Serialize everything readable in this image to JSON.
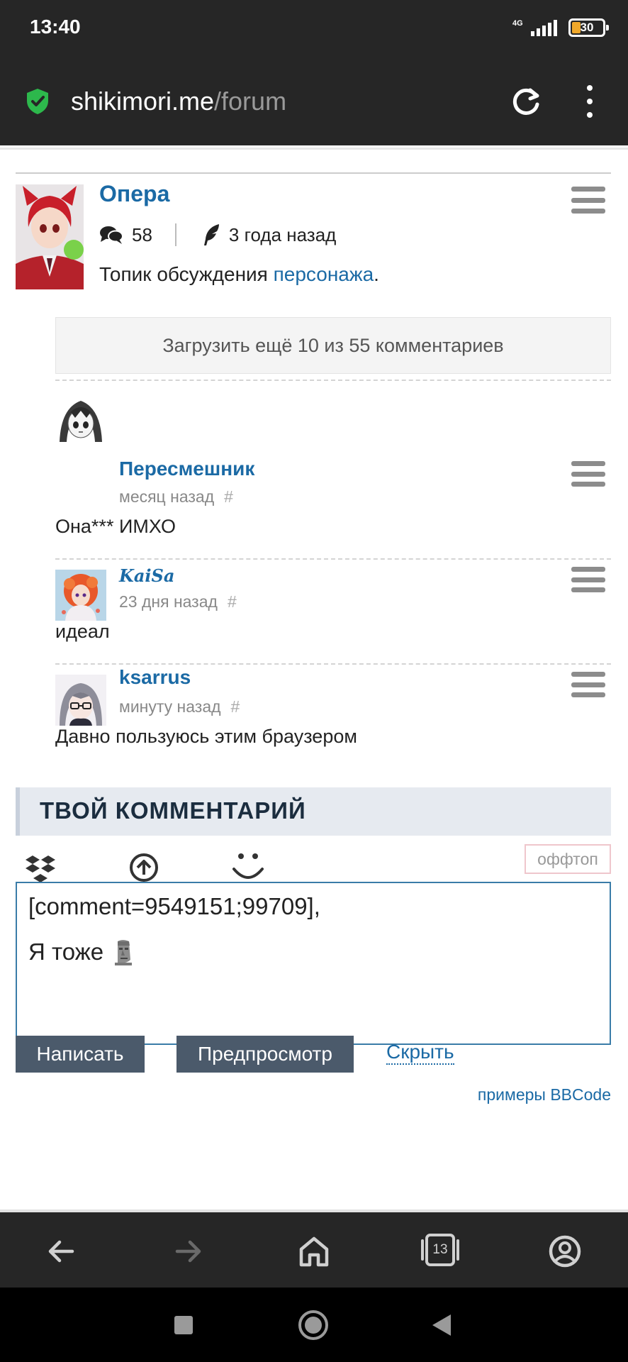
{
  "statusbar": {
    "time": "13:40",
    "network": "4G",
    "battery": "30"
  },
  "browser": {
    "url_domain": "shikimori.me",
    "url_path": "/forum"
  },
  "topic": {
    "title": "Опера",
    "comment_count": "58",
    "age": "3 года назад",
    "desc_prefix": "Топик обсуждения ",
    "desc_link": "персонажа",
    "desc_suffix": "."
  },
  "load_more": "Загрузить ещё 10 из 55 комментариев",
  "comments": [
    {
      "author": "Пересмешник",
      "time": "месяц назад",
      "hash": "#",
      "body": "Она*** ИМХО"
    },
    {
      "author": "KaiSa",
      "time": "23 дня назад",
      "hash": "#",
      "body": "идеал"
    },
    {
      "author": "ksarrus",
      "time": "минуту назад",
      "hash": "#",
      "body": "Давно пользуюсь этим браузером"
    }
  ],
  "reply": {
    "heading": "ТВОЙ КОММЕНТАРИЙ",
    "offtop": "оффтоп",
    "text_line1": "[comment=9549151;99709],",
    "text_line2": "Я тоже",
    "submit": "Написать",
    "preview": "Предпросмотр",
    "hide": "Скрыть",
    "bbcode": "примеры BBCode"
  },
  "bottom_nav": {
    "tabs_count": "13"
  },
  "colors": {
    "link": "#1b6aa5",
    "dark_bar": "#262626",
    "button": "#4b5a6b",
    "secure": "#2db84c"
  }
}
